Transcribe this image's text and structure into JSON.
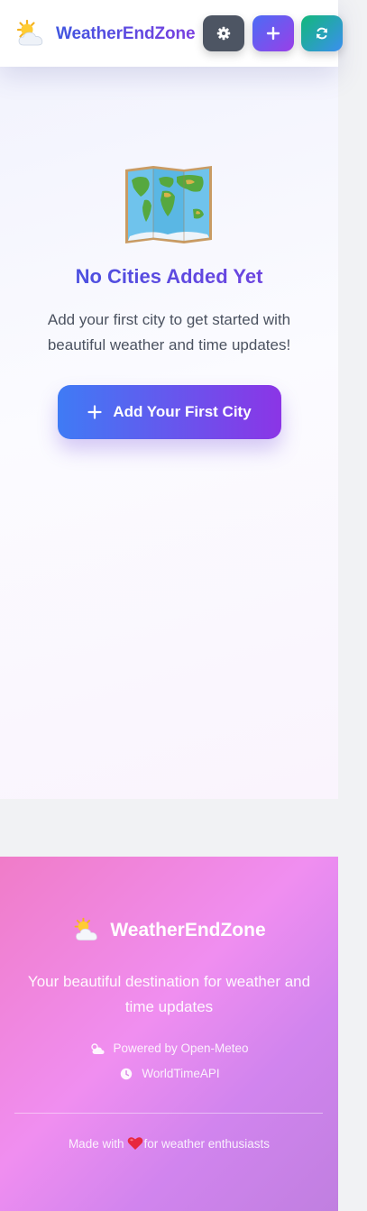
{
  "header": {
    "brand": "WeatherEndZone",
    "brand_icon": "sun-behind-cloud-icon",
    "buttons": {
      "settings_icon": "gear-icon",
      "add_icon": "plus-icon",
      "refresh_icon": "refresh-icon"
    }
  },
  "empty_state": {
    "icon": "world-map-icon",
    "title": "No Cities Added Yet",
    "description": "Add your first city to get started with beautiful weather and time updates!",
    "cta_label": "Add Your First City"
  },
  "footer": {
    "brand": "WeatherEndZone",
    "tagline": "Your beautiful destination for weather and time updates",
    "credits": [
      {
        "icon": "cloud-sun-icon",
        "label": "Powered by Open-Meteo"
      },
      {
        "icon": "clock-icon",
        "label": "WorldTimeAPI"
      }
    ],
    "made_prefix": "Made with",
    "made_suffix": "for weather enthusiasts"
  },
  "colors": {
    "brand_gradient_start": "#3f55e0",
    "brand_gradient_end": "#7a3fe0",
    "settings_button": "#4d5563",
    "refresh_gradient_start": "#12b87a",
    "refresh_gradient_end": "#3b8ff0",
    "footer_pink": "#f07cc8",
    "footer_violet": "#c07fe0",
    "heart": "#e8283f"
  }
}
